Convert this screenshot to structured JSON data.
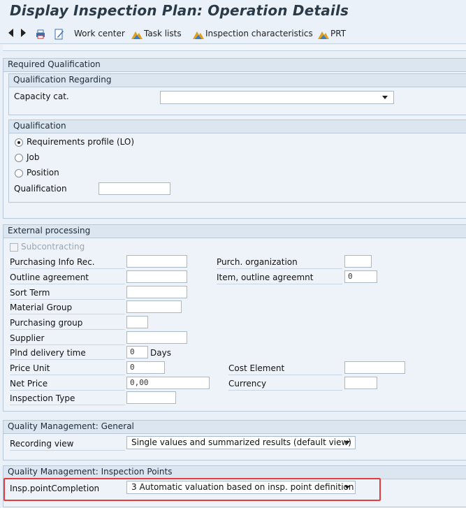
{
  "window": {
    "title": "Display Inspection Plan: Operation Details"
  },
  "toolbar": {
    "work_center": "Work center",
    "task_lists": "Task lists",
    "insp_chars": "Inspection characteristics",
    "prt": "PRT"
  },
  "required_qualification": {
    "title": "Required Qualification",
    "regarding": {
      "title": "Qualification Regarding",
      "capacity_cat_label": "Capacity cat.",
      "capacity_cat_value": ""
    },
    "qualification": {
      "title": "Qualification",
      "options": [
        "Requirements profile (LO)",
        "Job",
        "Position"
      ],
      "selected": "Requirements profile (LO)",
      "qualification_label": "Qualification",
      "qualification_value": ""
    }
  },
  "external_processing": {
    "title": "External processing",
    "subcontracting": "Subcontracting",
    "purch_info_rec": "Purchasing Info Rec.",
    "outline_agreement": "Outline agreement",
    "sort_term": "Sort Term",
    "material_group": "Material Group",
    "purchasing_group": "Purchasing group",
    "supplier": "Supplier",
    "plnd_delivery_time": "Plnd delivery time",
    "plnd_delivery_value": "0",
    "days": "Days",
    "price_unit": "Price Unit",
    "price_unit_value": "0",
    "net_price": "Net Price",
    "net_price_value": "0,00",
    "inspection_type": "Inspection Type",
    "purch_org": "Purch. organization",
    "item_outline": "Item, outline agreemnt",
    "item_outline_value": "0",
    "cost_element": "Cost Element",
    "currency": "Currency"
  },
  "qm_general": {
    "title": "Quality Management: General",
    "recording_view_label": "Recording view",
    "recording_view_value": "Single values and summarized results (default view)"
  },
  "qm_points": {
    "title": "Quality Management: Inspection Points",
    "completion_label": "Insp.pointCompletion",
    "completion_value": "3 Automatic valuation based on insp. point definition"
  },
  "colors": {
    "highlight": "#e53b3b",
    "title_text": "#2b3a48"
  }
}
